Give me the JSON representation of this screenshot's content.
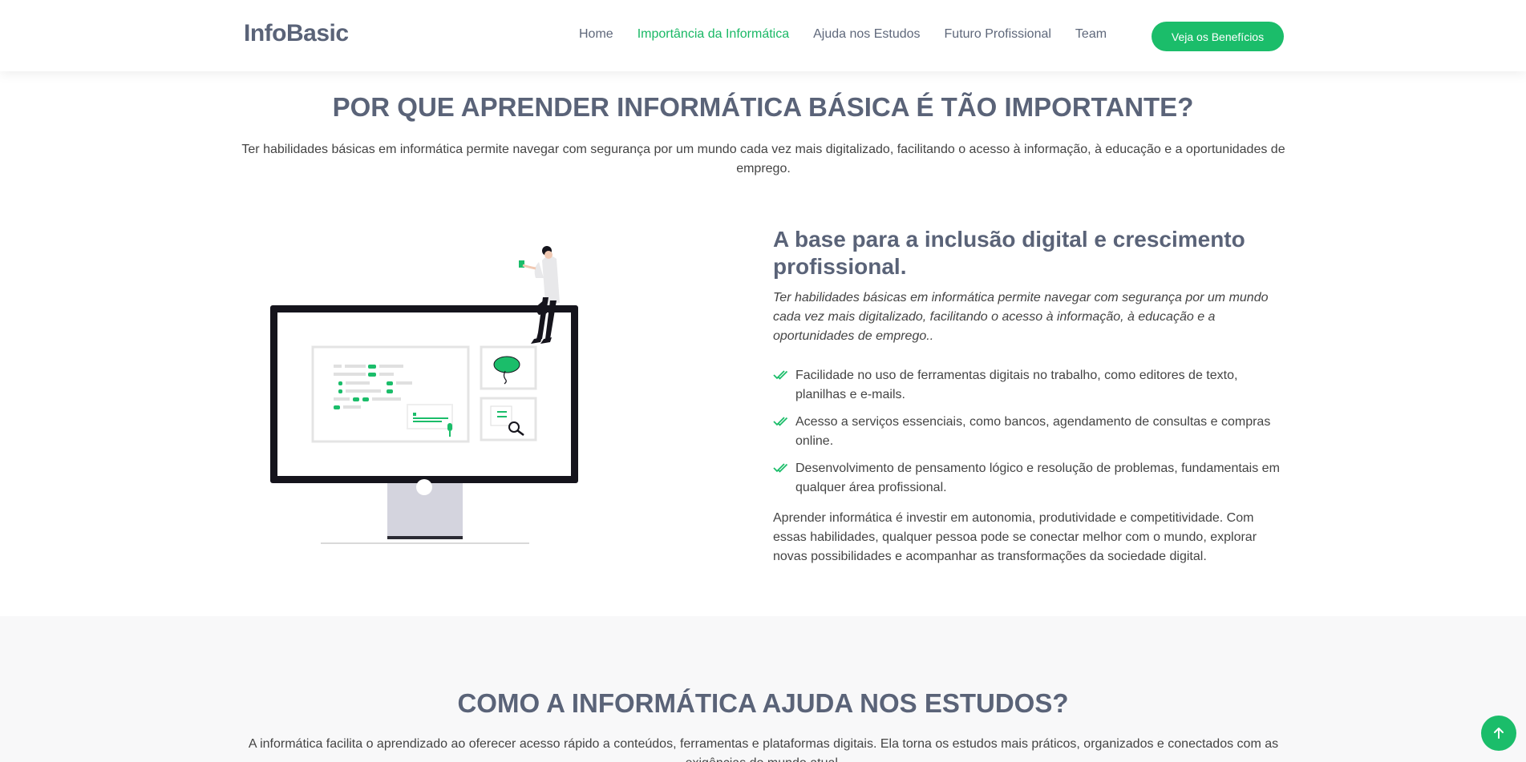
{
  "header": {
    "logo": "InfoBasic",
    "nav": [
      {
        "label": "Home"
      },
      {
        "label": "Importância da Informática"
      },
      {
        "label": "Ajuda nos Estudos"
      },
      {
        "label": "Futuro Profissional"
      },
      {
        "label": "Team"
      }
    ],
    "active_index": 1,
    "cta_label": "Veja os Benefícios"
  },
  "section1": {
    "title": "POR QUE APRENDER INFORMÁTICA BÁSICA É TÃO IMPORTANTE?",
    "subtitle": "Ter habilidades básicas em informática permite navegar com segurança por um mundo cada vez mais digitalizado, facilitando o acesso à informação, à educação e a oportunidades de emprego.",
    "heading": "A base para a inclusão digital e crescimento profissional.",
    "lead": "Ter habilidades básicas em informática permite navegar com segurança por um mundo cada vez mais digitalizado, facilitando o acesso à informação, à educação e a oportunidades de emprego..",
    "list": [
      {
        "text": "Facilidade no uso de ferramentas digitais no trabalho, como editores de texto, planilhas e e-mails."
      },
      {
        "text": "Acesso a serviços essenciais, como bancos, agendamento de consultas e compras online."
      },
      {
        "text": "Desenvolvimento de pensamento lógico e resolução de problemas, fundamentais em qualquer área profissional."
      }
    ],
    "closing": "Aprender informática é investir em autonomia, produtividade e competitividade. Com essas habilidades, qualquer pessoa pode se conectar melhor com o mundo, explorar novas possibilidades e acompanhar as transformações da sociedade digital."
  },
  "section2": {
    "title": "COMO A INFORMÁTICA AJUDA NOS ESTUDOS?",
    "subtitle": "A informática facilita o aprendizado ao oferecer acesso rápido a conteúdos, ferramentas e plataformas digitais. Ela torna os estudos mais práticos, organizados e conectados com as exigências do mundo atual."
  },
  "colors": {
    "accent": "#1bbd6a",
    "heading": "#5a6378",
    "section_alt_bg": "#f8f8f9"
  },
  "icons": {
    "list_check": "double-check-icon",
    "back_to_top": "arrow-up-icon"
  }
}
